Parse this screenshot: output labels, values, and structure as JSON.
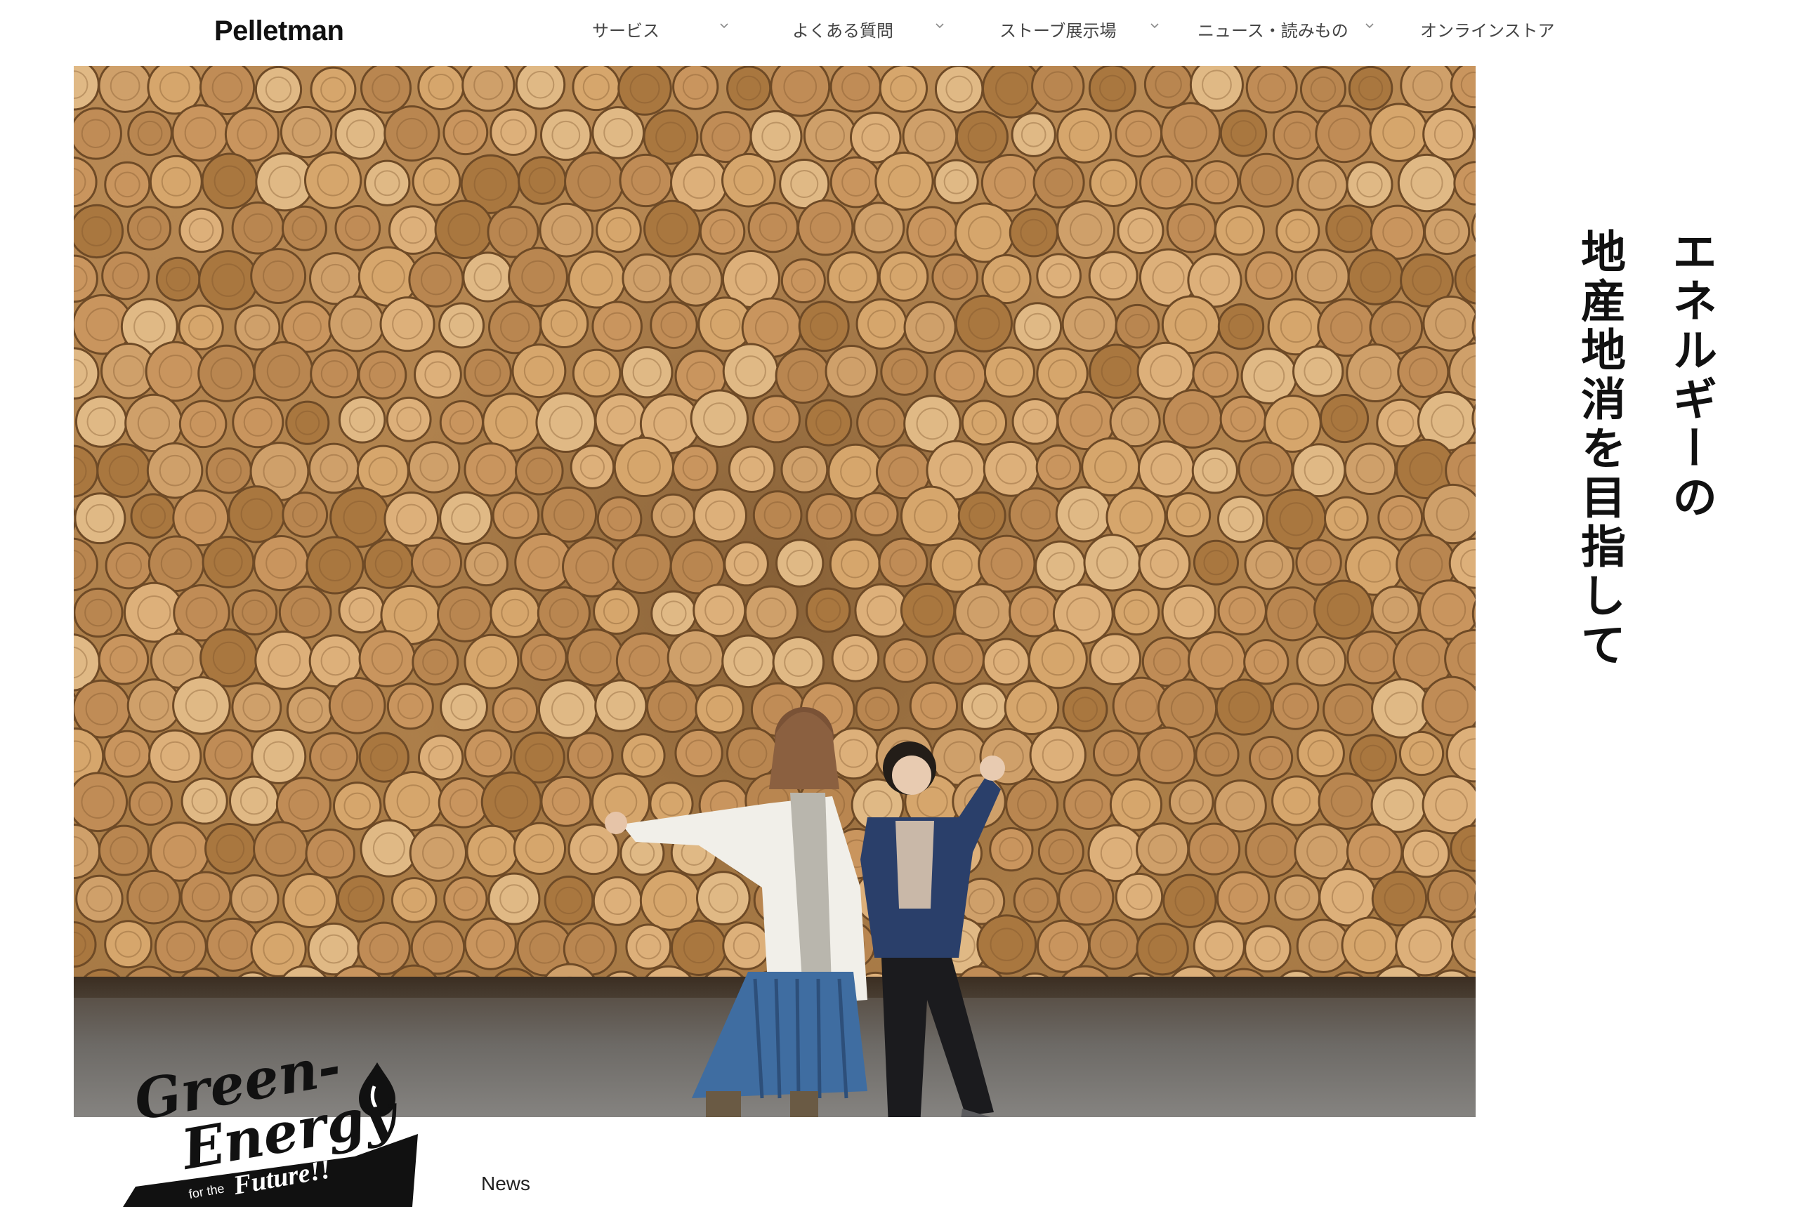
{
  "header": {
    "logo_text": "Pelletman",
    "nav": [
      {
        "label": "サービス",
        "has_dropdown": true
      },
      {
        "label": "よくある質問",
        "has_dropdown": true
      },
      {
        "label": "ストーブ展示場",
        "has_dropdown": true
      },
      {
        "label": "ニュース・読みもの",
        "has_dropdown": true
      },
      {
        "label": "オンラインストア",
        "has_dropdown": false
      }
    ]
  },
  "hero": {
    "image_subject": "stacked-log-wall-with-two-people",
    "headline_lines": [
      "エネルギーの",
      "地産地消を目指して"
    ]
  },
  "badge": {
    "line1": "Green-",
    "line2": "Energy",
    "tag_small": "for the",
    "tag_large": "Future!!"
  },
  "news": {
    "label": "News"
  },
  "colors": {
    "background": "#ffffff",
    "text": "#111111",
    "nav_text": "#444444"
  }
}
